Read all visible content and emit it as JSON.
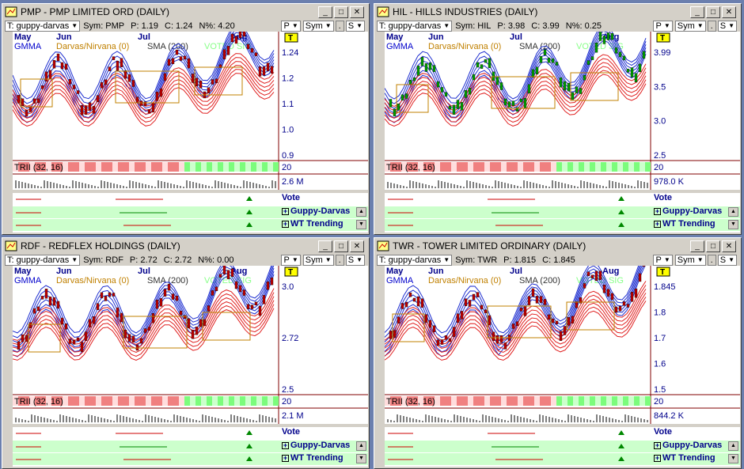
{
  "windows": [
    {
      "title": "PMP - PMP LIMITED  ORD (DAILY)",
      "template": "T: guppy-darvas",
      "sym": "Sym: PMP",
      "p": "P: 1.19",
      "c": "C: 1.24",
      "n": "N%: 4.20",
      "months": [
        "May",
        "Jun",
        "Jul",
        "Aug"
      ],
      "ind": {
        "gmma": "GMMA",
        "darvas": "Darvas/Nirvana (0)",
        "sma": "SMA (200)",
        "voted": "VOTED SIG"
      },
      "price_ticks": [
        "1.24",
        "1.2",
        "1.1",
        "1.0",
        "0.9"
      ],
      "trii": "TRII (32, 16)",
      "trii_val": "20",
      "vol": "2.6 M",
      "vote": "Vote",
      "guppy": "Guppy-Darvas",
      "wt": "WT Trending"
    },
    {
      "title": "HIL - HILLS INDUSTRIES (DAILY)",
      "template": "T: guppy-darvas",
      "sym": "Sym: HIL",
      "p": "P: 3.98",
      "c": "C: 3.99",
      "n": "N%: 0.25",
      "months": [
        "May",
        "Jun",
        "Jul",
        "Aug"
      ],
      "ind": {
        "gmma": "GMMA",
        "darvas": "Darvas/Nirvana (0)",
        "sma": "SMA (200)",
        "voted": "VOTED SIG"
      },
      "price_ticks": [
        "3.99",
        "3.5",
        "3.0",
        "2.5"
      ],
      "trii": "TRII (32, 16)",
      "trii_val": "20",
      "vol": "978.0 K",
      "vote": "Vote",
      "guppy": "Guppy-Darvas",
      "wt": "WT Trending"
    },
    {
      "title": "RDF - REDFLEX HOLDINGS (DAILY)",
      "template": "T: guppy-darvas",
      "sym": "Sym: RDF",
      "p": "P: 2.72",
      "c": "C: 2.72",
      "n": "N%: 0.00",
      "months": [
        "May",
        "Jun",
        "Jul",
        "Aug"
      ],
      "ind": {
        "gmma": "GMMA",
        "darvas": "Darvas/Nirvana (0)",
        "sma": "SMA (200)",
        "voted": "VOTED SIG"
      },
      "price_ticks": [
        "3.0",
        "2.72",
        "2.5"
      ],
      "trii": "TRII (32, 16)",
      "trii_val": "20",
      "vol": "2.1 M",
      "vote": "Vote",
      "guppy": "Guppy-Darvas",
      "wt": "WT Trending"
    },
    {
      "title": "TWR - TOWER LIMITED  ORDINARY (DAILY)",
      "template": "T: guppy-darvas",
      "sym": "Sym: TWR",
      "p": "P: 1.815",
      "c": "C: 1.845",
      "n": "",
      "months": [
        "May",
        "Jun",
        "Jul",
        "Aug"
      ],
      "ind": {
        "gmma": "GMMA",
        "darvas": "Darvas/Nirvana (0)",
        "sma": "SMA (200)",
        "voted": "VOTED SIG"
      },
      "price_ticks": [
        "1.845",
        "1.8",
        "1.7",
        "1.6",
        "1.5"
      ],
      "trii": "TRII (32, 16)",
      "trii_val": "20",
      "vol": "844.2 K",
      "vote": "Vote",
      "guppy": "Guppy-Darvas",
      "wt": "WT Trending"
    }
  ],
  "ui": {
    "p_btn": "P",
    "sym_btn": "Sym",
    "dot_btn": ".",
    "s_btn": "S",
    "t_marker": "T"
  },
  "colors": {
    "desktop": "#6b7fae",
    "accent": "#00008b",
    "trend_green": "#ccffcc",
    "trii_red": "#f08080"
  }
}
